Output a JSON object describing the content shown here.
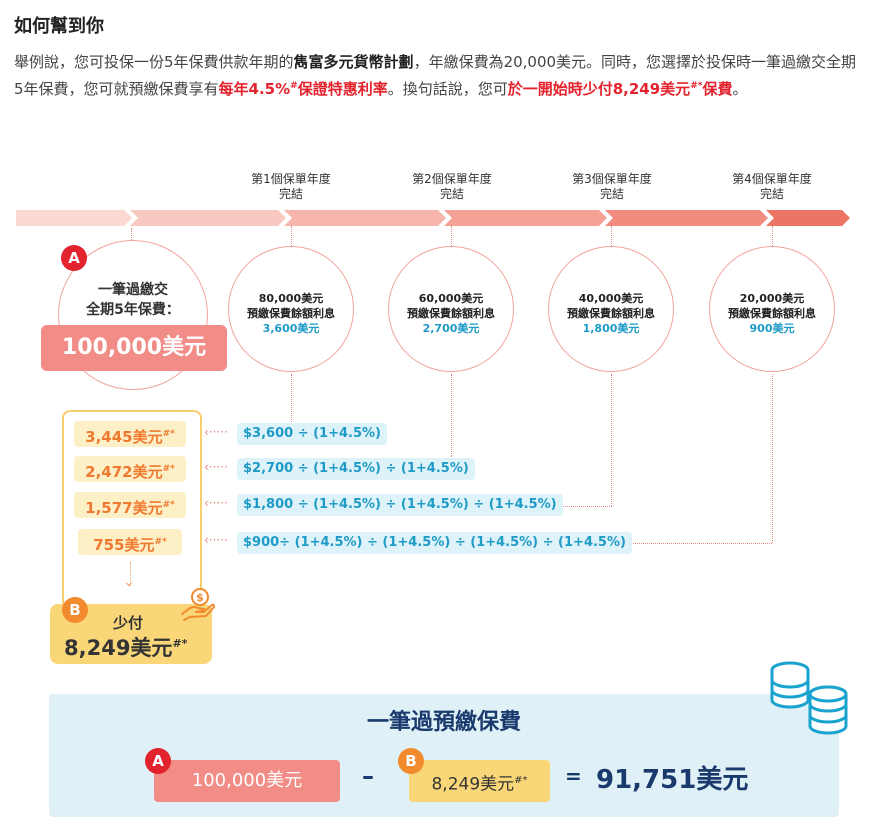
{
  "title": "如何幫到你",
  "intro": {
    "p1": "舉例說，您可投保一份5年保費供款年期的",
    "plan": "雋富多元貨幣計劃",
    "p2": "，年繳保費為20,000美元。同時，您選擇於投保時一筆過繳交全期5年保費，您可就預繳保費享有",
    "rate": "每年4.5%",
    "rate_mark": "#",
    "rate_rest": "保證特惠利率",
    "p3": "。換句話說，您可",
    "save": "於一開始時少付8,249美元",
    "save_mark": "#*",
    "save_rest": "保費",
    "p4": "。"
  },
  "timeline": {
    "years": [
      {
        "l1": "第1個保單年度",
        "l2": "完結"
      },
      {
        "l1": "第2個保單年度",
        "l2": "完結"
      },
      {
        "l1": "第3個保單年度",
        "l2": "完結"
      },
      {
        "l1": "第4個保單年度",
        "l2": "完結"
      }
    ],
    "circles": [
      {
        "amount": "80,000美元",
        "label": "預繳保費餘額利息",
        "interest": "3,600美元"
      },
      {
        "amount": "60,000美元",
        "label": "預繳保費餘額利息",
        "interest": "2,700美元"
      },
      {
        "amount": "40,000美元",
        "label": "預繳保費餘額利息",
        "interest": "1,800美元"
      },
      {
        "amount": "20,000美元",
        "label": "預繳保費餘額利息",
        "interest": "900美元"
      }
    ]
  },
  "section_a": {
    "badge": "A",
    "line1": "一筆過繳交",
    "line2": "全期5年保費：",
    "amount": "100,000美元"
  },
  "discounts": [
    {
      "amount": "3,445美元",
      "mark": "#*",
      "calc": "$3,600 ÷ (1+4.5%)"
    },
    {
      "amount": "2,472美元",
      "mark": "#*",
      "calc": "$2,700 ÷ (1+4.5%) ÷ (1+4.5%)"
    },
    {
      "amount": "1,577美元",
      "mark": "#*",
      "calc": "$1,800 ÷ (1+4.5%) ÷ (1+4.5%) ÷ (1+4.5%)"
    },
    {
      "amount": "755美元",
      "mark": "#*",
      "calc": "$900÷ (1+4.5%) ÷ (1+4.5%) ÷ (1+4.5%) ÷ (1+4.5%)"
    }
  ],
  "section_b": {
    "badge": "B",
    "label": "少付",
    "amount": "8,249美元",
    "mark": "#*"
  },
  "summary": {
    "title": "一筆過預繳保費",
    "a_badge": "A",
    "a_amount": "100,000美元",
    "minus": "–",
    "b_badge": "B",
    "b_amount": "8,249美元",
    "b_mark": "#*",
    "equals": "=",
    "total": "91,751美元"
  },
  "icons": {
    "hand": "hand-coin-icon",
    "coins": "coin-stack-icon",
    "arrow_left": "‹",
    "arrow_down": "⌄"
  },
  "colors": {
    "accent_red": "#e2232d",
    "salmon": "#f18c87",
    "yellow": "#f9d677",
    "blue_text": "#1e9bc7",
    "navy": "#1a3a6e",
    "panel": "#dff0f6"
  }
}
